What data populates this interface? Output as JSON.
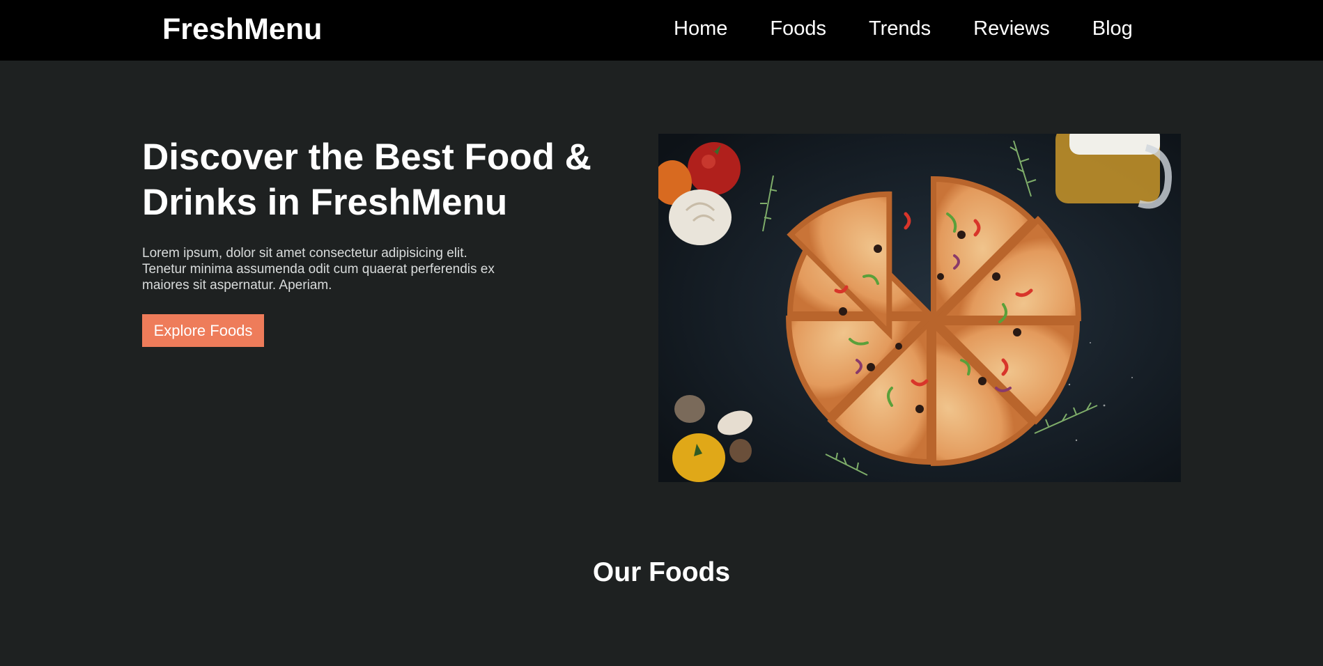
{
  "header": {
    "brand": "FreshMenu",
    "nav": [
      "Home",
      "Foods",
      "Trends",
      "Reviews",
      "Blog"
    ]
  },
  "hero": {
    "title": "Discover the Best Food & Drinks in FreshMenu",
    "description": "Lorem ipsum, dolor sit amet consectetur adipisicing elit. Tenetur minima assumenda odit cum quaerat perferendis ex maiores sit aspernatur. Aperiam.",
    "cta_label": "Explore Foods",
    "image_subject": "pizza-photo"
  },
  "sections": {
    "foods_title": "Our Foods"
  },
  "colors": {
    "page_background": "#1e2121",
    "navbar_background": "#000000",
    "accent": "#ee7c5a",
    "text": "#ffffff"
  }
}
